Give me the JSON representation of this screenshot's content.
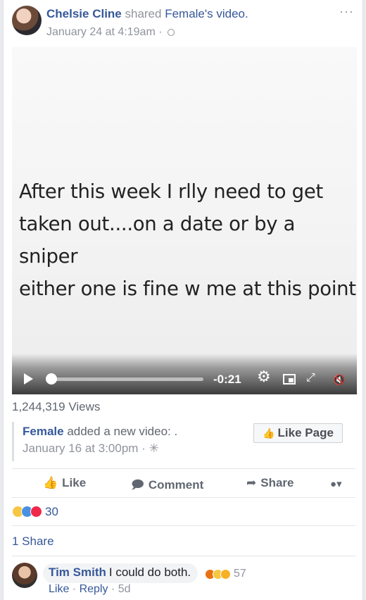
{
  "post": {
    "author": "Chelsie Cline",
    "shared_text": " shared ",
    "source_page": "Female",
    "possessive_video": "'s video.",
    "timestamp": "January 24 at 4:19am",
    "sep": " · ",
    "more": "···"
  },
  "video": {
    "caption_lines": [
      "After this week I rlly need to get",
      "taken out....on a date or by a sniper",
      "either one is fine w me at this point"
    ],
    "time_remaining": "-0:21",
    "progress_fraction": 0.0
  },
  "views": "1,244,319 Views",
  "shared_from": {
    "page": "Female",
    "action_text": " added a new video: .",
    "timestamp": "January 16 at 3:00pm",
    "sep": " · ",
    "like_page_label": "Like Page"
  },
  "actions": {
    "like": "Like",
    "comment": "Comment",
    "share": "Share"
  },
  "reactions": {
    "count": "30"
  },
  "shares": "1 Share",
  "comment": {
    "author": "Tim Smith",
    "text": "I could do both.",
    "reaction_count": "57",
    "like": "Like",
    "reply": "Reply",
    "age": "5d",
    "sep": " · "
  }
}
